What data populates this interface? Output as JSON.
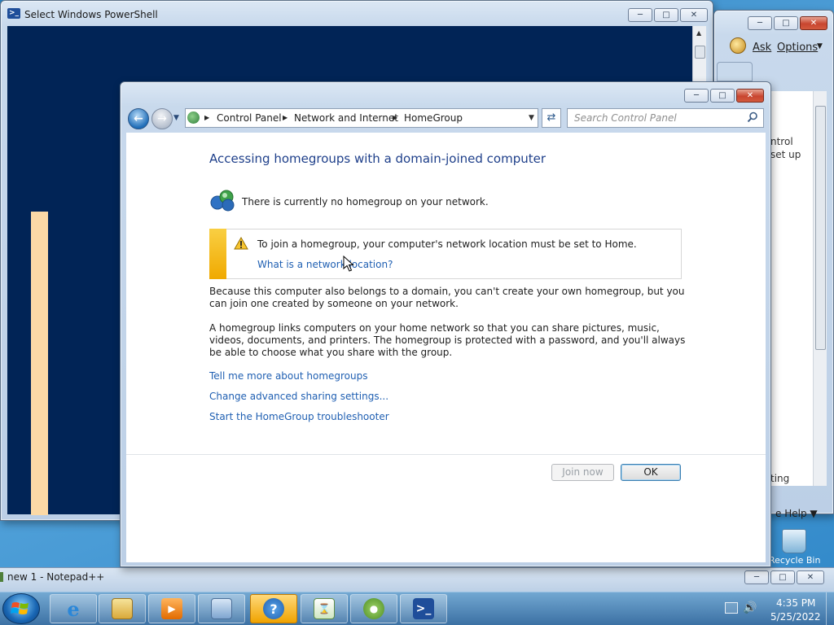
{
  "powershell": {
    "title": "Select Windows PowerShell",
    "console_color": "#012456"
  },
  "help_window": {
    "ask": "Ask",
    "options": "Options",
    "text_line1": "ntrol",
    "text_line2": "set up",
    "text_line3": "ting",
    "help_menu": "e Help"
  },
  "notepad": {
    "title": "new 1 - Notepad++"
  },
  "desktop": {
    "recycle_bin": "Recycle Bin"
  },
  "homegroup": {
    "breadcrumb": [
      "Control Panel",
      "Network and Internet",
      "HomeGroup"
    ],
    "search_placeholder": "Search Control Panel",
    "heading": "Accessing homegroups with a domain-joined computer",
    "no_homegroup": "There is currently no homegroup on your network.",
    "warning": {
      "text": "To join a homegroup, your computer's network location must be set to Home.",
      "link": "What is a network location?"
    },
    "paragraph1": "Because this computer also belongs to a domain, you can't create your own homegroup, but you can join one created by someone on your network.",
    "paragraph2": "A homegroup links computers on your home network so that you can share pictures, music, videos, documents, and printers. The homegroup is protected with a password, and you'll always be able to choose what you share with the group.",
    "links": [
      "Tell me more about homegroups",
      "Change advanced sharing settings...",
      "Start the HomeGroup troubleshooter"
    ],
    "buttons": {
      "join_now": "Join now",
      "ok": "OK"
    },
    "accent_color": "#1e3f8a",
    "link_color": "#1f5fb2",
    "warning_color": "#f0a900"
  },
  "taskbar": {
    "items": [
      "internet-explorer",
      "windows-explorer",
      "media-player",
      "control-panel",
      "help-and-support",
      "notepad-plus-plus",
      "ftp-client",
      "powershell"
    ],
    "time": "4:35 PM",
    "date": "5/25/2022"
  }
}
